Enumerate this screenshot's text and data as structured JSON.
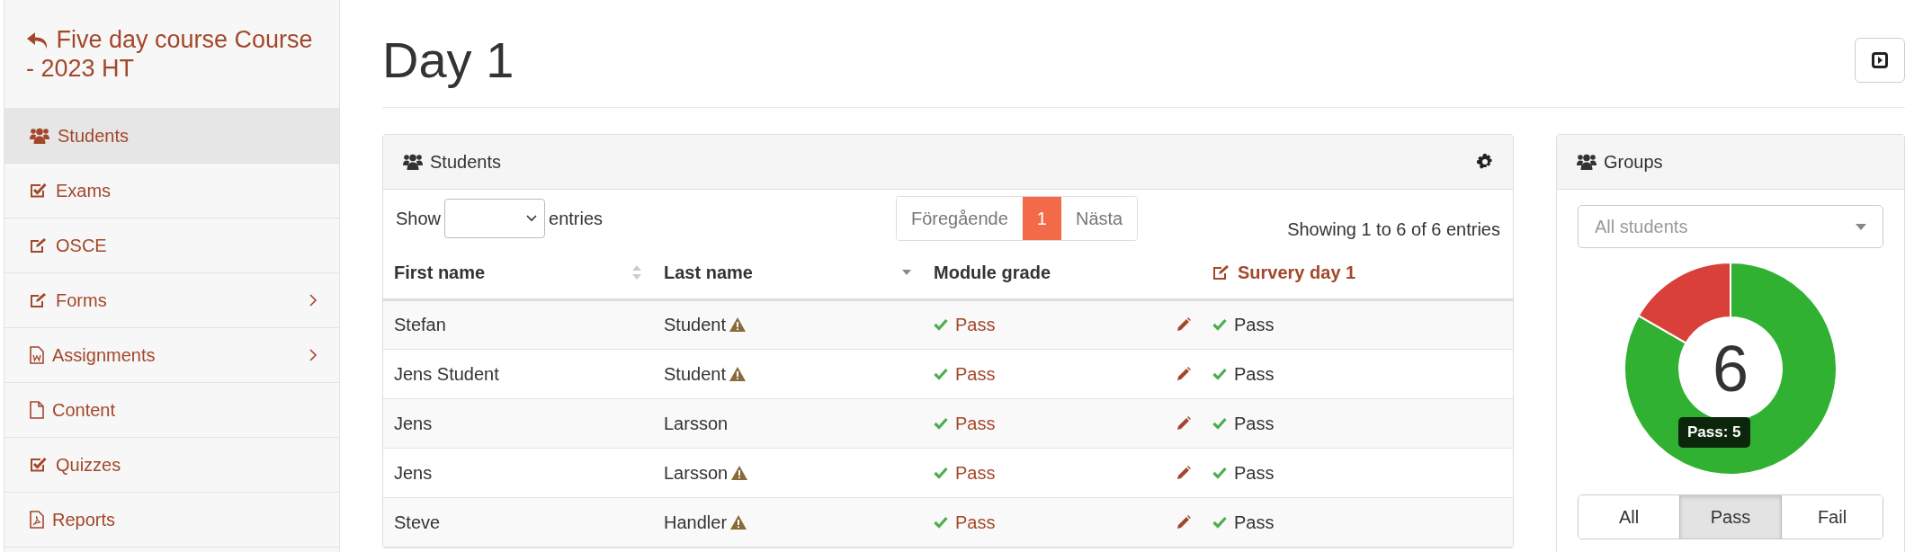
{
  "sidebar": {
    "title": "Five day course Course - 2023 HT",
    "items": [
      {
        "label": "Students",
        "kind": "users",
        "selected": true,
        "submenu": false
      },
      {
        "label": "Exams",
        "kind": "check",
        "selected": false,
        "submenu": false
      },
      {
        "label": "OSCE",
        "kind": "edit",
        "selected": false,
        "submenu": false
      },
      {
        "label": "Forms",
        "kind": "edit",
        "selected": false,
        "submenu": true
      },
      {
        "label": "Assignments",
        "kind": "word",
        "selected": false,
        "submenu": true
      },
      {
        "label": "Content",
        "kind": "file",
        "selected": false,
        "submenu": false
      },
      {
        "label": "Quizzes",
        "kind": "check",
        "selected": false,
        "submenu": false
      },
      {
        "label": "Reports",
        "kind": "pdf",
        "selected": false,
        "submenu": false
      }
    ]
  },
  "page": {
    "title": "Day 1"
  },
  "students_panel": {
    "title": "Students",
    "length_label_before": "Show",
    "length_label_after": "entries",
    "pagination": [
      {
        "label": "Föregående",
        "selected": false
      },
      {
        "label": "1",
        "selected": true
      },
      {
        "label": "Nästa",
        "selected": false
      }
    ],
    "info": "Showing 1 to 6 of 6 entries",
    "columns": [
      {
        "label": "First name",
        "kind": "sortable"
      },
      {
        "label": "Last name",
        "kind": "sorted"
      },
      {
        "label": "Module grade",
        "kind": "plain"
      },
      {
        "label": "Survery day 1",
        "kind": "link"
      }
    ],
    "rows": [
      {
        "first_name": "Stefan",
        "last_name": "Student",
        "warning": true,
        "module_grade": "Pass",
        "survey": "Pass"
      },
      {
        "first_name": "Jens Student",
        "last_name": "Student",
        "warning": true,
        "module_grade": "Pass",
        "survey": "Pass"
      },
      {
        "first_name": "Jens",
        "last_name": "Larsson",
        "warning": false,
        "module_grade": "Pass",
        "survey": "Pass"
      },
      {
        "first_name": "Jens",
        "last_name": "Larsson",
        "warning": true,
        "module_grade": "Pass",
        "survey": "Pass"
      },
      {
        "first_name": "Steve",
        "last_name": "Handler",
        "warning": true,
        "module_grade": "Pass",
        "survey": "Pass"
      }
    ]
  },
  "groups_panel": {
    "title": "Groups",
    "select": {
      "placeholder": "All students"
    },
    "center_label": "6",
    "tooltip": "Pass: 5",
    "chart_data": {
      "type": "donut",
      "series": [
        {
          "values": [
            83.33,
            16.67
          ]
        }
      ],
      "colors": [
        "#31b131",
        "#d9403a"
      ]
    },
    "filters": [
      {
        "label": "All",
        "selected": false
      },
      {
        "label": "Pass",
        "selected": true
      },
      {
        "label": "Fail",
        "selected": false
      }
    ]
  }
}
